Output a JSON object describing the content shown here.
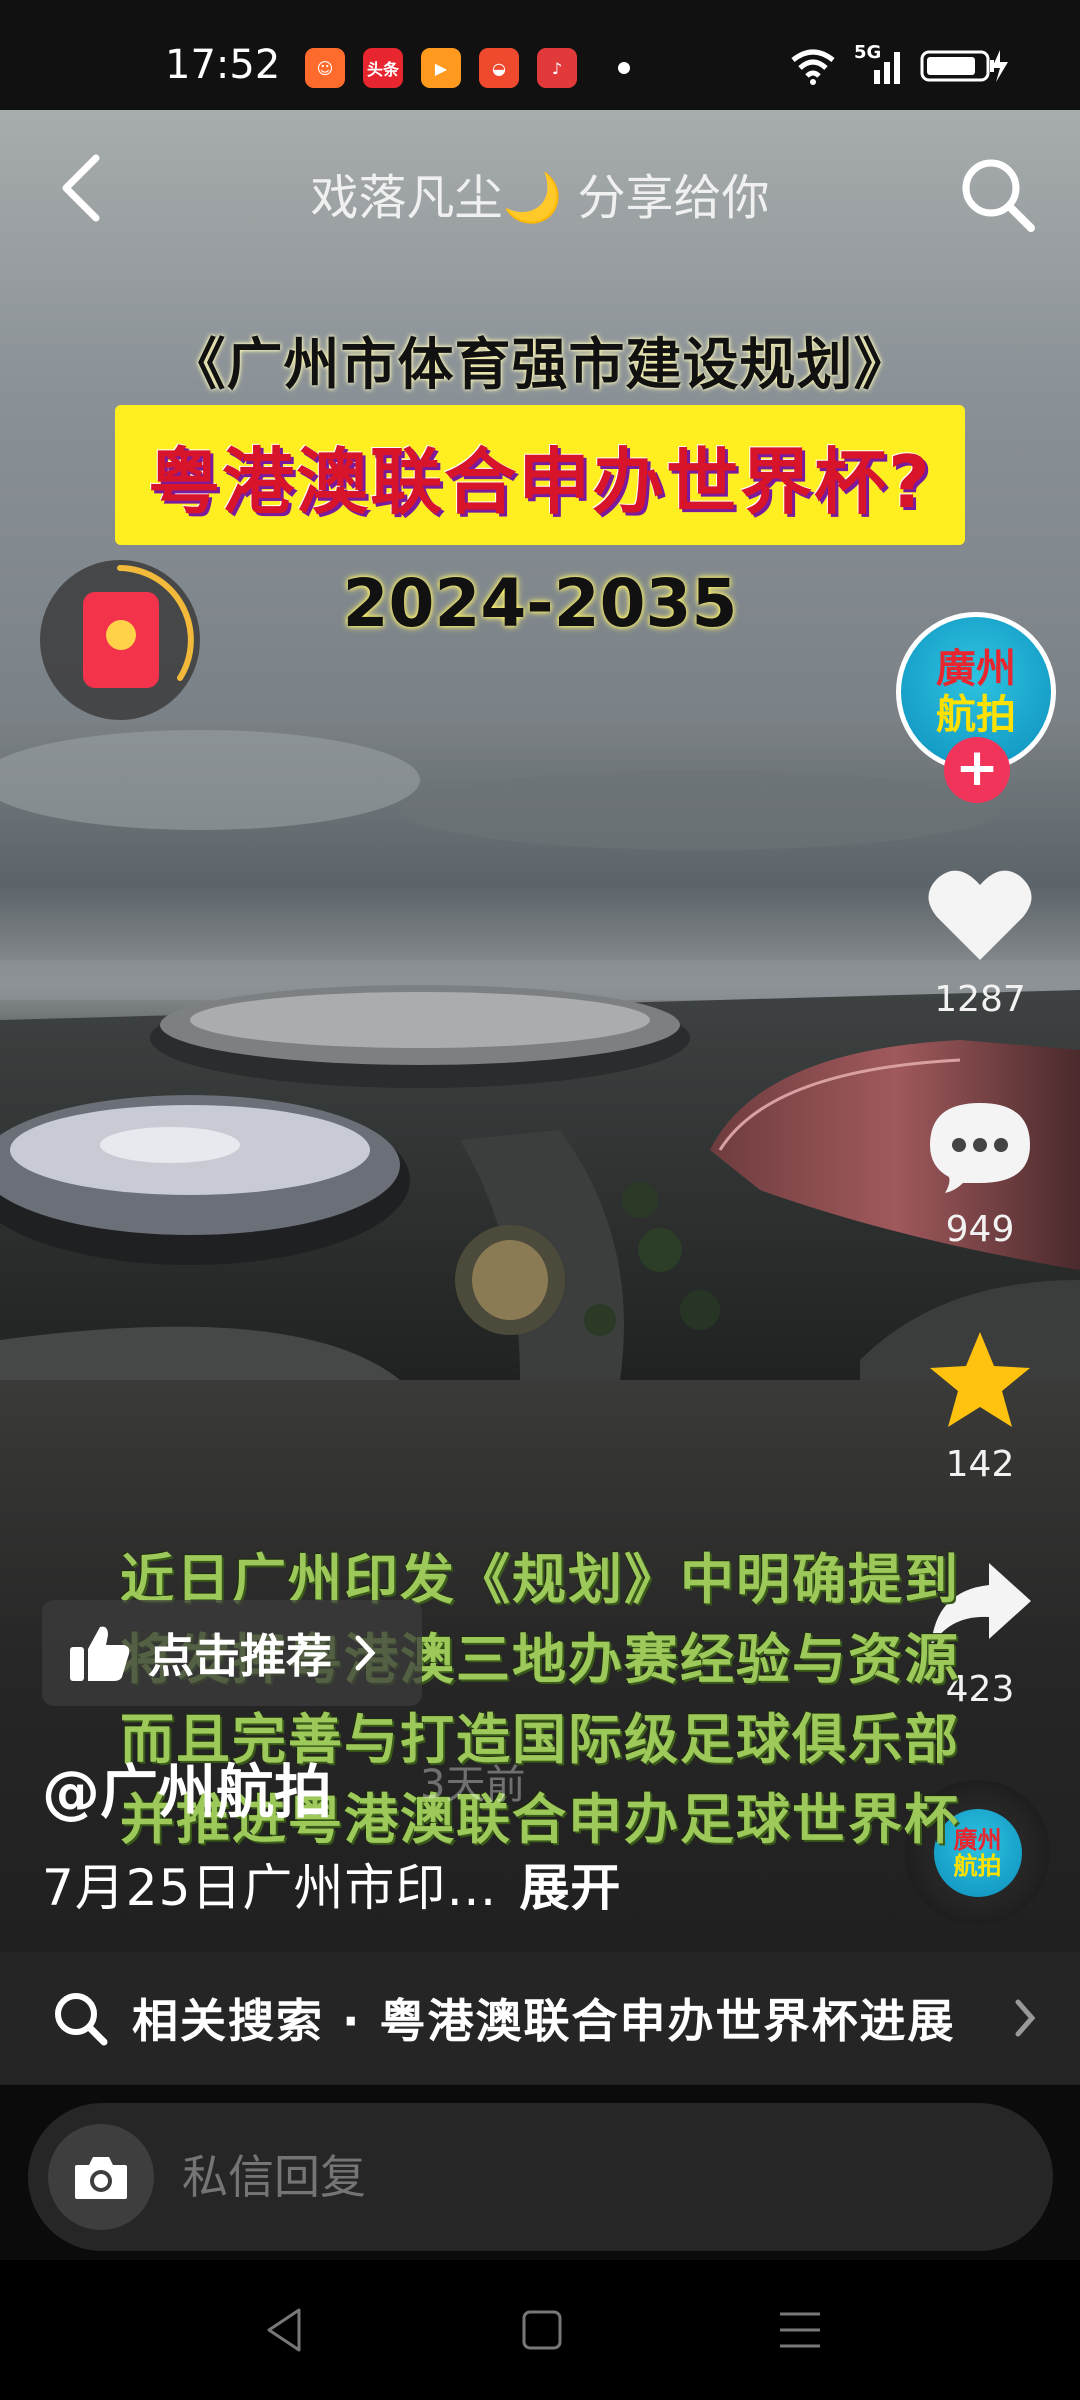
{
  "status_bar": {
    "time": "17:52",
    "apps": [
      {
        "name": "app-icon-1",
        "color": "#ff6b2d",
        "label": ""
      },
      {
        "name": "toutiao-app-icon",
        "color": "#e8262f",
        "label": "头条"
      },
      {
        "name": "video-app-icon",
        "color": "#ff9a1f",
        "label": ""
      },
      {
        "name": "app-icon-4",
        "color": "#f04a2e",
        "label": ""
      },
      {
        "name": "tiktok-app-icon",
        "color": "#e23a3a",
        "label": ""
      }
    ],
    "network": "5G"
  },
  "header": {
    "title": "戏落凡尘🌙 分享给你"
  },
  "video": {
    "headline": "《广州市体育强市建设规划》",
    "banner": "粤港澳联合申办世界杯?",
    "years": "2024-2035",
    "subtitles": [
      "近日广州印发《规划》中明确提到",
      "将发挥粤港澳三地办赛经验与资源",
      "而且完善与打造国际级足球俱乐部",
      "并推进粤港澳联合申办足球世界杯"
    ]
  },
  "author": {
    "avatar_text_line1": "廣州",
    "avatar_text_line2": "航拍",
    "handle": "@广州航拍",
    "time_ago": "3天前"
  },
  "actions": {
    "likes": "1287",
    "comments": "949",
    "favorites": "142",
    "shares": "423"
  },
  "recommend": {
    "label": "点击推荐"
  },
  "caption": {
    "text": "7月25日广州市印…",
    "expand": "展开"
  },
  "related_search": {
    "text": "相关搜索 · 粤港澳联合申办世界杯进展"
  },
  "reply": {
    "placeholder": "私信回复"
  },
  "colors": {
    "accent_pink": "#f0345a",
    "star_yellow": "#ffc20e",
    "banner_yellow": "#ffef20",
    "banner_red": "#d8142a"
  }
}
